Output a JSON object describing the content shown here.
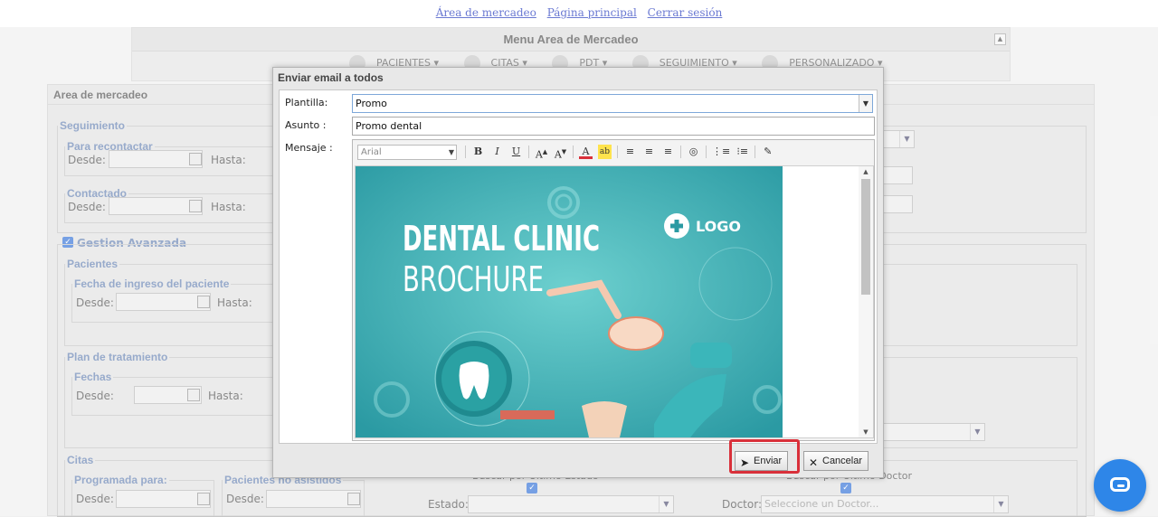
{
  "top_links": [
    "Área de mercadeo",
    "Página principal",
    "Cerrar sesión"
  ],
  "menu": {
    "title": "Menu Area de Mercadeo",
    "items": [
      "PACIENTES ▾",
      "CITAS ▾",
      "PDT ▾",
      "SEGUIMIENTO ▾",
      "PERSONALIZADO ▾"
    ]
  },
  "area": {
    "title": "Area de mercadeo",
    "seguimiento": {
      "legend": "Seguimiento",
      "para_recontactar": "Para recontactar",
      "contactado": "Contactado",
      "desde": "Desde:",
      "hasta": "Hasta:"
    },
    "gestion_avanzada": "Gestion Avanzada",
    "pacientes": {
      "legend": "Pacientes",
      "fecha_ingreso": "Fecha de ingreso del paciente",
      "desde": "Desde:",
      "hasta": "Hasta:"
    },
    "plan": {
      "legend": "Plan de tratamiento",
      "fechas": "Fechas",
      "desde": "Desde:",
      "hasta": "Hasta:"
    },
    "citas": {
      "legend": "Citas",
      "programada": "Programada para:",
      "no_asistidos": "Pacientes no asistidos",
      "desde": "Desde:",
      "buscar_estado": "Buscar por Último Estado",
      "buscar_doctor": "Buscar por Último Doctor",
      "estado_label": "Estado:",
      "doctor_label": "Doctor:",
      "doctor_placeholder": "Seleccione un Doctor..."
    }
  },
  "modal": {
    "title": "Enviar email a todos",
    "plantilla_label": "Plantilla:",
    "plantilla_value": "Promo",
    "asunto_label": "Asunto :",
    "asunto_value": "Promo dental",
    "mensaje_label": "Mensaje :",
    "font_value": "Arial",
    "toolbar_glyphs": {
      "bold": "B",
      "italic": "I",
      "underline": "U"
    },
    "image": {
      "line1": "DENTAL CLINIC",
      "line2": "BROCHURE",
      "logo": "LOGO",
      "bg_color": "#35a6ad"
    },
    "enviar": "Enviar",
    "cancelar": "Cancelar"
  },
  "colors": {
    "highlight": "#d9303a",
    "chat": "#2e86e8",
    "legend": "#6a86b5"
  }
}
